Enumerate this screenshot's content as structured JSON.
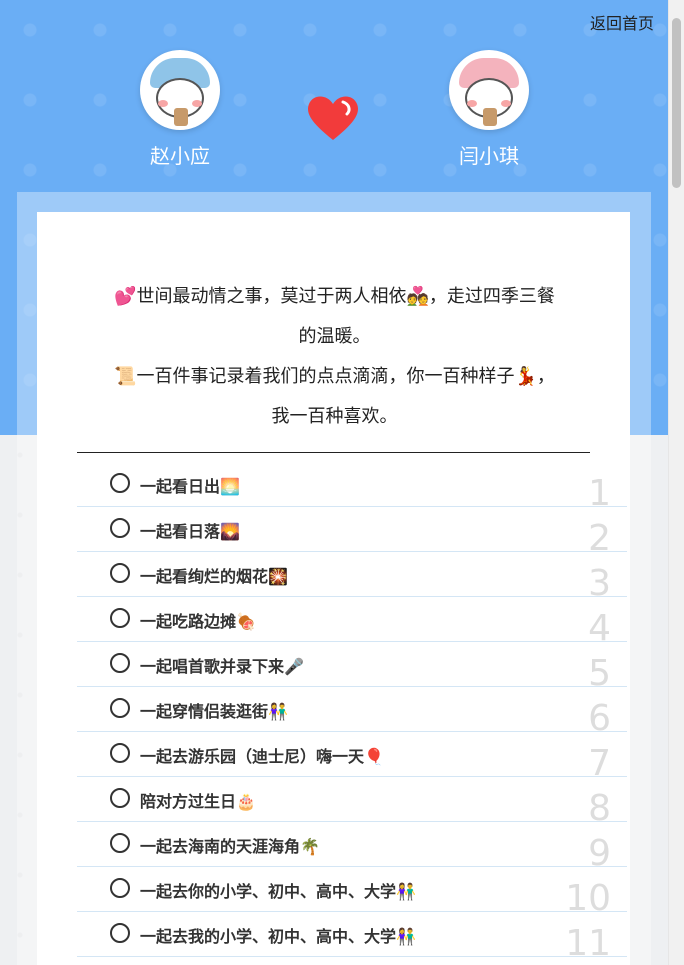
{
  "header": {
    "back_label": "返回首页"
  },
  "couple": {
    "left": {
      "name": "赵小应",
      "avatar_icon": "bear-blue-hat-avatar"
    },
    "right": {
      "name": "闫小琪",
      "avatar_icon": "bear-pink-hat-avatar"
    },
    "heart_icon": "heart-icon",
    "heart_color": "#f23b3b"
  },
  "intro": {
    "line1": "💕世间最动情之事，莫过于两人相依💑，走过四季三餐的温暖。",
    "line2": "📜一百件事记录着我们的点点滴滴，你一百种样子💃，我一百种喜欢。"
  },
  "items": [
    {
      "label": "一起看日出🌅",
      "num": "1"
    },
    {
      "label": "一起看日落🌄",
      "num": "2"
    },
    {
      "label": "一起看绚烂的烟花🎇",
      "num": "3"
    },
    {
      "label": "一起吃路边摊🍖",
      "num": "4"
    },
    {
      "label": "一起唱首歌并录下来🎤",
      "num": "5"
    },
    {
      "label": "一起穿情侣装逛街👫",
      "num": "6"
    },
    {
      "label": "一起去游乐园（迪士尼）嗨一天🎈",
      "num": "7"
    },
    {
      "label": "陪对方过生日🎂",
      "num": "8"
    },
    {
      "label": "一起去海南的天涯海角🌴",
      "num": "9"
    },
    {
      "label": "一起去你的小学、初中、高中、大学👫",
      "num": "10"
    },
    {
      "label": "一起去我的小学、初中、高中、大学👫",
      "num": "11"
    }
  ],
  "colors": {
    "hero_bg": "#6aaef5",
    "row_divider": "#d4e6f5"
  }
}
